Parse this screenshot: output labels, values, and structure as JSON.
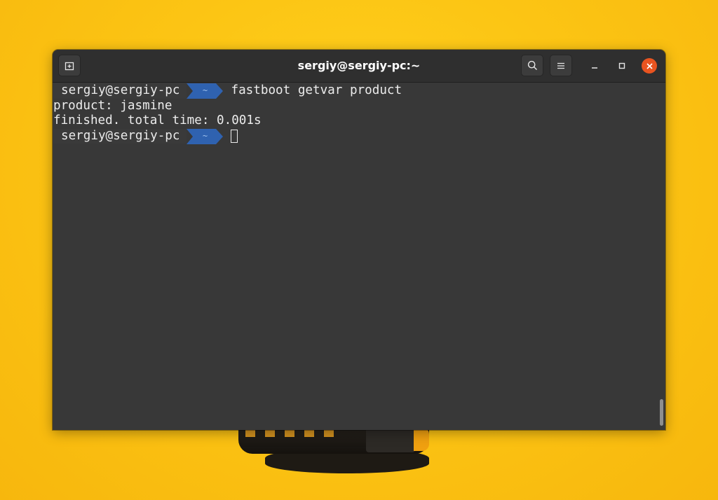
{
  "window": {
    "title": "sergiy@sergiy-pc:~"
  },
  "terminal": {
    "lines": [
      {
        "type": "prompt",
        "user": "sergiy@sergiy-pc",
        "dir": "~",
        "command": "fastboot getvar product"
      },
      {
        "type": "output",
        "text": "product: jasmine"
      },
      {
        "type": "output",
        "text": "finished. total time: 0.001s"
      },
      {
        "type": "prompt",
        "user": "sergiy@sergiy-pc",
        "dir": "~",
        "command": ""
      }
    ]
  },
  "colors": {
    "prompt_dir_bg": "#2f62b0",
    "close_button": "#e95420",
    "background": "#fcc514"
  },
  "icons": {
    "new_tab": "new-tab-icon",
    "search": "search-icon",
    "menu": "hamburger-menu-icon",
    "minimize": "minimize-icon",
    "maximize": "maximize-icon",
    "close": "close-icon"
  }
}
